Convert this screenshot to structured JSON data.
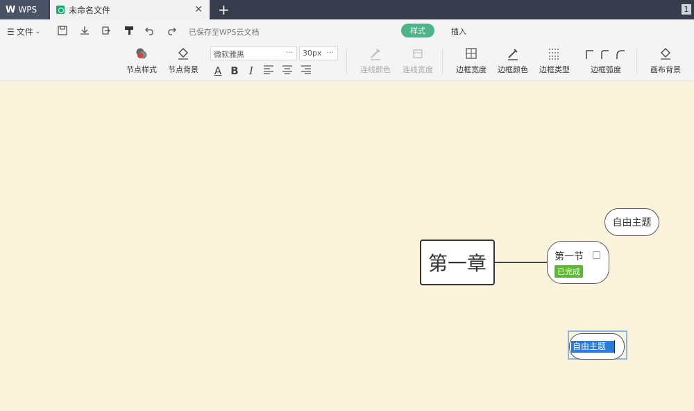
{
  "tabs": {
    "wps_label": "WPS",
    "doc_title": "未命名文件",
    "badge": "1"
  },
  "toolbar1": {
    "file_menu": "文件",
    "saved_status": "已保存至WPS云文档",
    "tab_style": "样式",
    "tab_insert": "插入"
  },
  "toolbar2": {
    "node_style": "节点样式",
    "node_bg": "节点背景",
    "font_family": "微软雅黑",
    "font_size": "30px",
    "line_color": "连线颜色",
    "line_width": "连线宽度",
    "border_width": "边框宽度",
    "border_color": "边框颜色",
    "border_type": "边框类型",
    "border_radius": "边框弧度",
    "canvas_bg": "画布背景",
    "fmt_color": "A",
    "fmt_bold": "B",
    "fmt_italic": "I"
  },
  "mindmap": {
    "root": "第一章",
    "section": "第一节",
    "section_tag": "已完成",
    "free_topic": "自由主题",
    "editing_topic": "自由主题"
  },
  "colors": {
    "canvas_bg": "#fbf3dc",
    "accent_green": "#4db48a",
    "done_tag": "#5cb82e",
    "selection": "#2a7bd6"
  }
}
